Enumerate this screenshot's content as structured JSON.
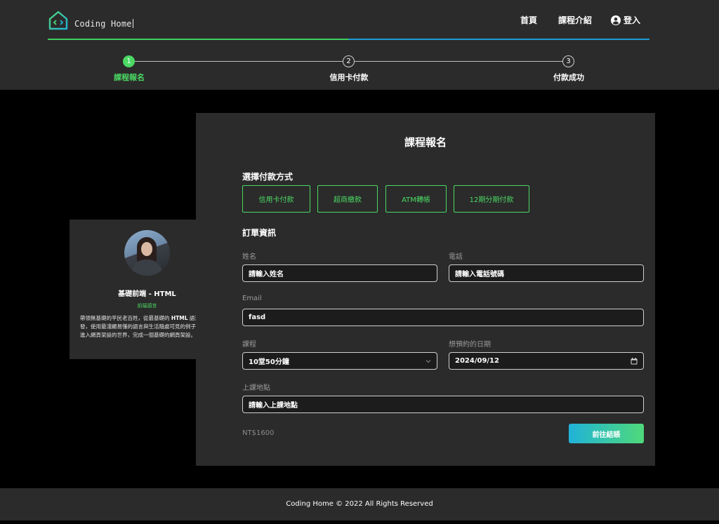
{
  "header": {
    "logo_text": "Coding Home",
    "nav": {
      "home": "首頁",
      "courses": "課程介紹",
      "login": "登入"
    }
  },
  "stepper": {
    "steps": [
      {
        "number": "1",
        "label": "課程報名",
        "active": true
      },
      {
        "number": "2",
        "label": "信用卡付款",
        "active": false
      },
      {
        "number": "3",
        "label": "付款成功",
        "active": false
      }
    ]
  },
  "course_card": {
    "title": "基礎前端 - HTML",
    "tag": "前端語言",
    "description_before": "帶領無基礎的平民老百姓，從最基礎的 ",
    "description_bold": "HTML",
    "description_after": " 語法出發，使用最淺顯易懂的語言與生活隨處可見的例子，輕鬆進入網頁架設的世界，完成一個基礎的網頁架設。"
  },
  "form": {
    "title": "課程報名",
    "payment_section": "選擇付款方式",
    "payment_methods": [
      "信用卡付款",
      "超商繳款",
      "ATM轉帳",
      "12期分期付款"
    ],
    "order_section": "訂單資訊",
    "name": {
      "label": "姓名",
      "value": "請輸入姓名"
    },
    "phone": {
      "label": "電話",
      "value": "請輸入電話號碼"
    },
    "email": {
      "label": "Email",
      "value": "fasd"
    },
    "course": {
      "label": "課程",
      "value": "10堂50分鐘"
    },
    "date": {
      "label": "想預約的日期",
      "value": "2024/09/12"
    },
    "location": {
      "label": "上課地點",
      "value": "請輸入上課地點"
    },
    "price": "NT$1600",
    "checkout_label": "前往結賬"
  },
  "footer": {
    "text": "Coding Home © 2022 All Rights Reserved"
  },
  "colors": {
    "accent_green": "#4bd964",
    "accent_blue": "#1d9bd6",
    "panel_bg": "#2b2b2b",
    "page_bg": "#000000"
  }
}
